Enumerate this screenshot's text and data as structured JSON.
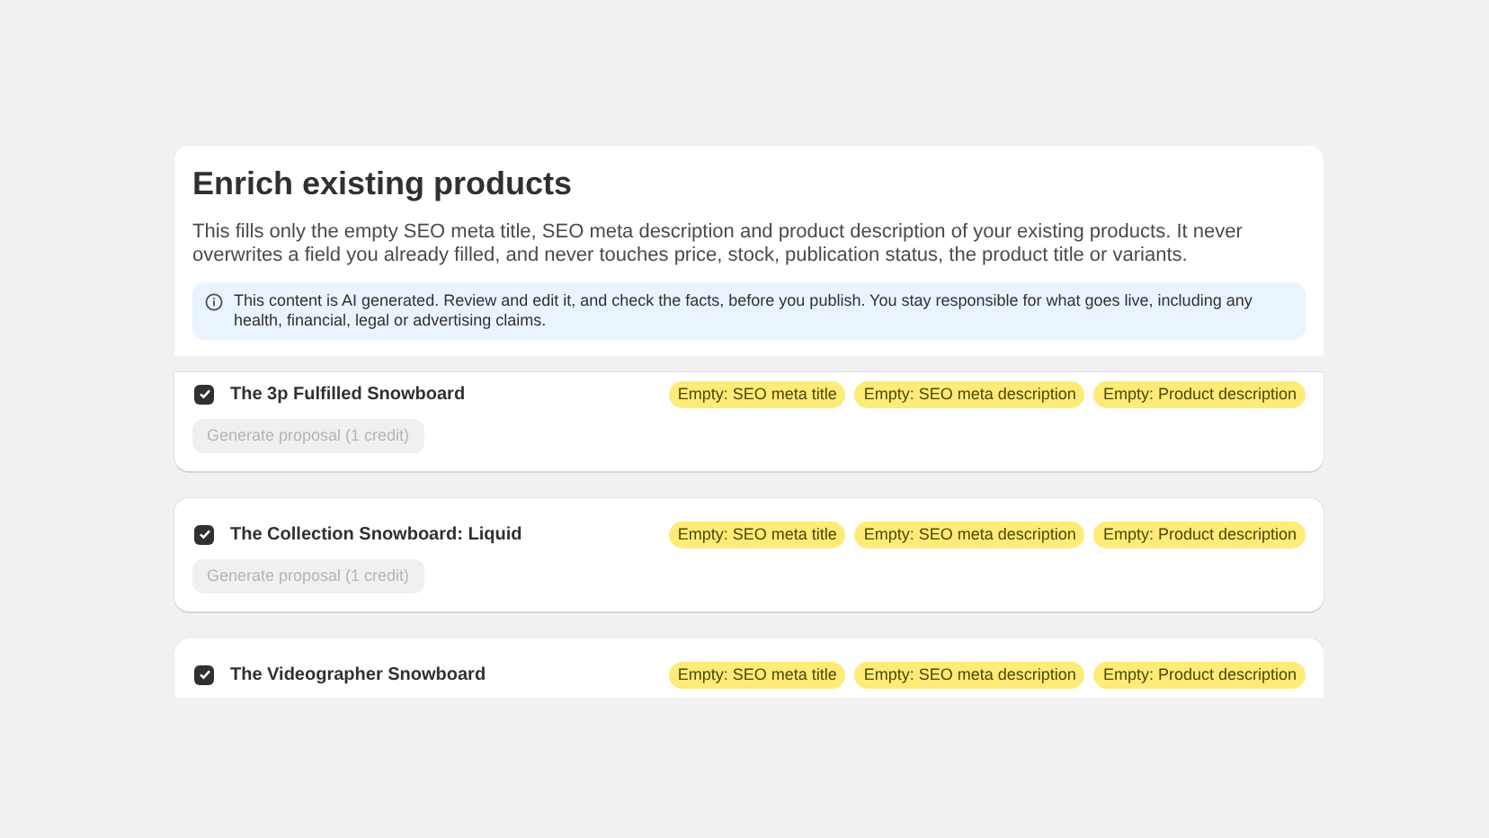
{
  "heading": "Enrich existing products",
  "description": "This fills only the empty SEO meta title, SEO meta description and product description of your existing products. It never overwrites a field you already filled, and never touches price, stock, publication status, the product title or variants.",
  "notice": "This content is AI generated. Review and edit it, and check the facts, before you publish. You stay responsible for what goes live, including any health, financial, legal or advertising claims.",
  "products": [
    {
      "title": "The 3p Fulfilled Snowboard",
      "checked": true,
      "tags": [
        "Empty: SEO meta title",
        "Empty: SEO meta description",
        "Empty: Product description"
      ],
      "button": {
        "label": "Generate proposal (1 credit)",
        "disabled": true
      }
    },
    {
      "title": "The Collection Snowboard: Liquid",
      "checked": true,
      "tags": [
        "Empty: SEO meta title",
        "Empty: SEO meta description",
        "Empty: Product description"
      ],
      "button": {
        "label": "Generate proposal (1 credit)",
        "disabled": true
      }
    },
    {
      "title": "The Videographer Snowboard",
      "checked": true,
      "tags": [
        "Empty: SEO meta title",
        "Empty: SEO meta description",
        "Empty: Product description"
      ]
    }
  ]
}
